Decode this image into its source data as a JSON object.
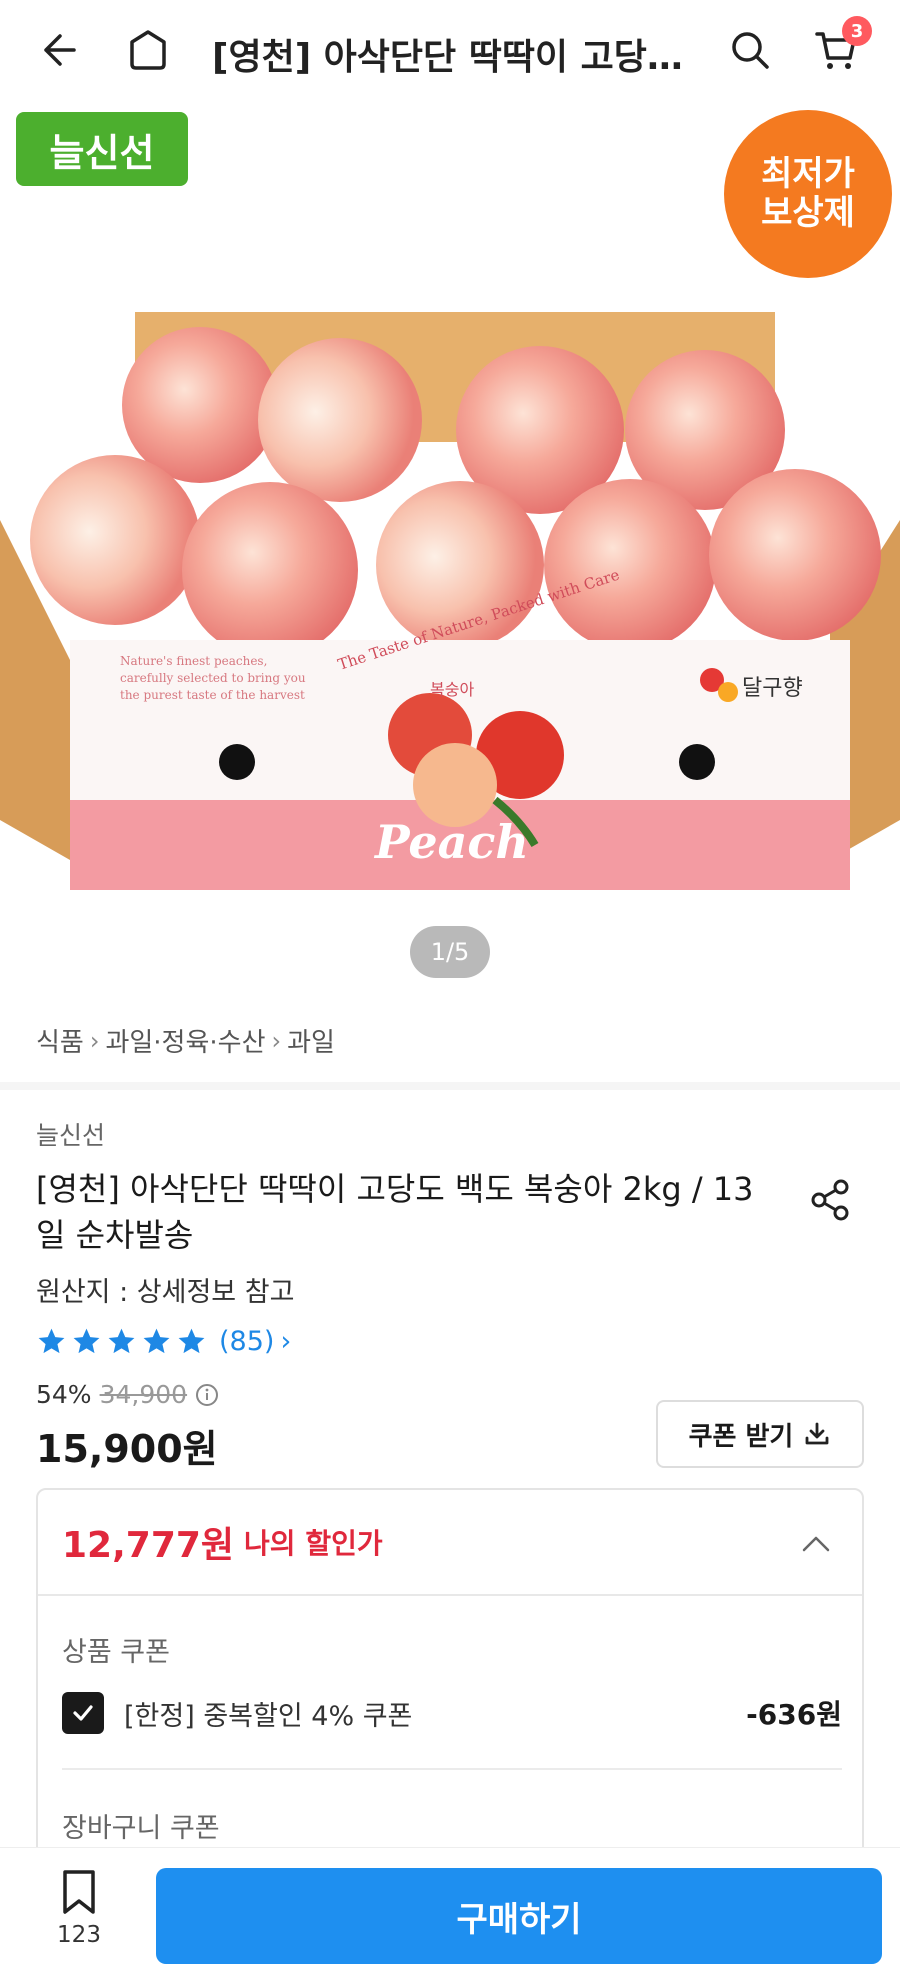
{
  "header": {
    "title": "[영천] 아삭단단 딱딱이 고당도 …",
    "back_icon": "back-arrow-icon",
    "home_icon": "home-icon",
    "search_icon": "search-icon",
    "cart_icon": "cart-icon",
    "cart_count": "3"
  },
  "hero": {
    "badge_left": "늘신선",
    "badge_right_line1": "최저가",
    "badge_right_line2": "보상제",
    "box_text": "Peach",
    "box_korean": "복숭아",
    "box_arc_text": "The Taste of Nature, Packed with Care",
    "box_side_text_line1": "Nature's finest peaches,",
    "box_side_text_line2": "carefully selected to bring you",
    "box_side_text_line3": "the purest taste of the harvest",
    "box_brand": "달구향",
    "image_counter": "1/5"
  },
  "breadcrumb": {
    "items": [
      "식품",
      "과일·정육·수산",
      "과일"
    ]
  },
  "product": {
    "seller": "늘신선",
    "title": "[영천] 아삭단단 딱딱이 고당도 백도 복숭아 2kg / 13일 순차발송",
    "origin": "원산지 : 상세정보 참고",
    "rating_stars": 5,
    "review_count": "(85)",
    "discount_rate": "54%",
    "original_price": "34,900",
    "price": "15,900원",
    "coupon_button": "쿠폰 받기"
  },
  "discount_panel": {
    "my_price": "12,777원",
    "my_price_label": "나의 할인가",
    "product_coupon_label": "상품 쿠폰",
    "coupon_name": "[한정] 중복할인 4% 쿠폰",
    "coupon_amount": "-636원",
    "cart_coupon_label": "장바구니 쿠폰"
  },
  "bottom_bar": {
    "save_count": "123",
    "buy_label": "구매하기"
  },
  "colors": {
    "accent_blue": "#1e8ff0",
    "price_red": "#e0283c",
    "badge_green": "#4caf2e",
    "badge_orange": "#f47a20"
  }
}
